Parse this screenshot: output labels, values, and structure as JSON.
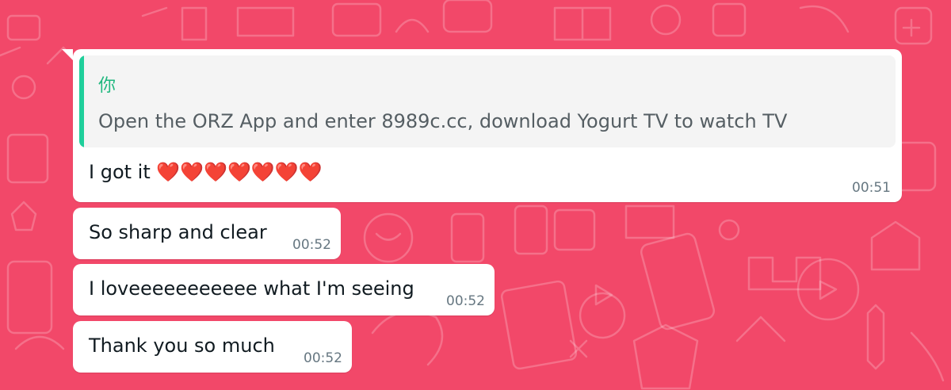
{
  "messages": [
    {
      "quoted_author": "你",
      "quoted_text": "Open the ORZ App and enter 8989c.cc, download Yogurt TV to watch TV",
      "text": "I got it ❤️❤️❤️❤️❤️❤️❤️",
      "time": "00:51"
    },
    {
      "text": "So sharp and clear",
      "time": "00:52"
    },
    {
      "text": "I loveeeeeeeeeee what I'm seeing",
      "time": "00:52"
    },
    {
      "text": "Thank you so much",
      "time": "00:52"
    }
  ],
  "colors": {
    "background": "#f24869",
    "bubble": "#ffffff",
    "quote_bar": "#1fcf9b",
    "quote_author": "#1fb77e",
    "timestamp": "#667781"
  }
}
